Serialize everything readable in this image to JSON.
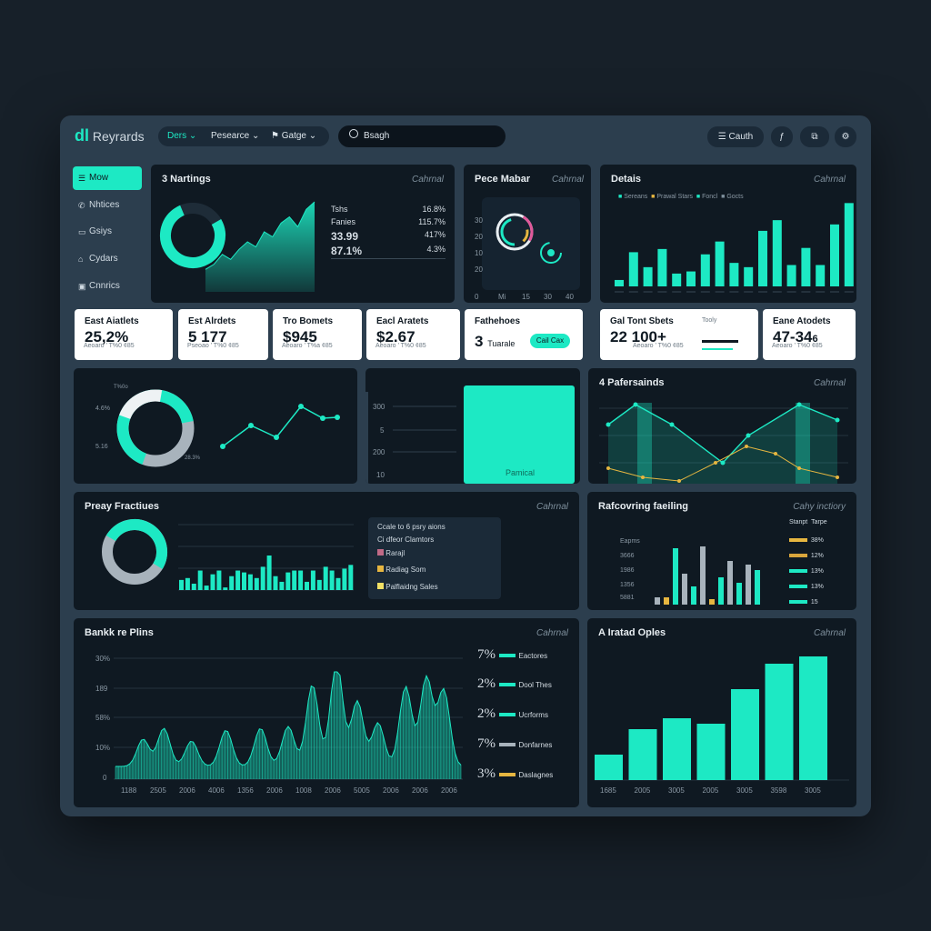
{
  "app": {
    "title": "Reyrards"
  },
  "nav": {
    "items": [
      "Ders",
      "Pesearce",
      "Gatge"
    ]
  },
  "search": {
    "placeholder": "Bsagh"
  },
  "header": {
    "calendar_label": "Cauth"
  },
  "sidebar": {
    "items": [
      "Mow",
      "Nhtices",
      "Gsiys",
      "Cydars",
      "Cnnrics"
    ]
  },
  "panels": {
    "ratings": {
      "title": "3 Nartings",
      "control": "Cahrnal",
      "stats": [
        {
          "label": "Tshs",
          "value": "16.8%"
        },
        {
          "label": "Fanies",
          "value": "115.7%"
        },
        {
          "label": "33.99",
          "value": "417%"
        },
        {
          "label": "87.1%",
          "value": "4.3%"
        }
      ]
    },
    "pece": {
      "title": "Pece Mabar",
      "control": "Cahrnal",
      "ylabels": [
        "30",
        "20",
        "10",
        "20"
      ],
      "xlabels": [
        "0",
        "Mi",
        "15",
        "30",
        "40"
      ]
    },
    "details": {
      "title": "Detais",
      "control": "Cahrnal",
      "legend": [
        "Sereans",
        "Prawal Stars",
        "Foncl",
        "Gocts"
      ]
    },
    "pref": {
      "title": "4 Pafersainds",
      "control": "Cahrnal"
    },
    "prey": {
      "title": "Preay Fractiues",
      "control": "Cahrnal"
    },
    "recov": {
      "title": "Rafcovring faeiling",
      "control": "Cahy inctiory",
      "legend_headers": [
        "Stanpt",
        "Tarpe"
      ],
      "legend_vals": [
        "38%",
        "12%",
        "13%",
        "13%",
        "15"
      ]
    },
    "bank": {
      "title": "Bankk re Plins",
      "control": "Cahrnal"
    },
    "irated": {
      "title": "A Iratad Oples",
      "control": "Cahrnal"
    }
  },
  "cards": [
    {
      "label": "East Aiatlets",
      "value": "25,2%",
      "sub": "Aeoaro ’ T%0 ¢85"
    },
    {
      "label": "Est Alrdets",
      "value": "5 177",
      "sub": "Pseoao ’ T%0 ¢85"
    },
    {
      "label": "Tro Bomets",
      "value": "$945",
      "sub": "Aeoaro ’ T%a ¢85"
    },
    {
      "label": "Eacl Aratets",
      "value": "$2.67",
      "sub": "Aeoaro ’ T%0 ¢85"
    },
    {
      "label": "Fathehoes",
      "value": "3",
      "unit": "Tuarale",
      "button": "Cail Cax"
    },
    {
      "label": "Gal Tont Sbets",
      "value": "22 100+",
      "sub": "Aeoaro ’ T%0 ¢85",
      "mini": "Tooly"
    },
    {
      "label": "Eane Atodets",
      "value": "47-34",
      "unit": "6",
      "sub": "Aeoaro ’ T%0 ¢85"
    }
  ],
  "mid": {
    "bar_label": "Pamical",
    "yticks": [
      "300",
      "5",
      "200",
      "10"
    ],
    "donut_labels": [
      "T%0o",
      "4.6%",
      "5.16",
      "28.3%"
    ]
  },
  "prey_legend": {
    "title": "Ccale to 6 psry aions",
    "subtitle": "Ci dfeor Clamtors",
    "items": [
      {
        "label": "Rarajl",
        "color": "#c06a86"
      },
      {
        "label": "Radiag Som",
        "color": "#e6b640"
      },
      {
        "label": "Palflaidng Sales",
        "color": "#f2e065"
      }
    ]
  },
  "bank_legend": [
    {
      "pct": "7%",
      "label": "Eactores"
    },
    {
      "pct": "2%",
      "label": "Dool Thes"
    },
    {
      "pct": "2%",
      "label": "Ucrforms"
    },
    {
      "pct": "7%",
      "label": "Donfarnes"
    },
    {
      "pct": "3%",
      "label": "Daslagnes"
    }
  ],
  "bank_axes": {
    "y": [
      "30%",
      "189",
      "58%",
      "10%",
      "0"
    ],
    "x": [
      "1188",
      "2505",
      "2006",
      "4006",
      "1356",
      "2006",
      "1008",
      "2006",
      "5005",
      "2006",
      "2006",
      "2006"
    ]
  },
  "irated_axes": {
    "x": [
      "1685",
      "2005",
      "3005",
      "2005",
      "3005",
      "3598",
      "3005"
    ]
  },
  "recov_axes": {
    "y": [
      "Eapms",
      "3666",
      "1986",
      "1356",
      "5881"
    ]
  },
  "chart_data": [
    {
      "type": "area",
      "title": "3 Nartings",
      "values": [
        18,
        22,
        30,
        26,
        34,
        40,
        36,
        48,
        44,
        55,
        60,
        52,
        66,
        72
      ]
    },
    {
      "type": "bar",
      "title": "Detais",
      "values": [
        6,
        32,
        18,
        35,
        12,
        14,
        30,
        42,
        22,
        18,
        52,
        62,
        20,
        36,
        20,
        58,
        78
      ]
    },
    {
      "type": "bar",
      "title": "Preay Fractiues",
      "values": [
        34,
        36,
        30,
        44,
        28,
        40,
        44,
        26,
        38,
        44,
        42,
        40,
        36,
        48,
        60,
        38,
        32,
        42,
        44,
        44,
        32,
        44,
        34,
        48,
        44,
        36,
        46,
        50
      ]
    },
    {
      "type": "bar",
      "title": "A Iratad Oples",
      "values": [
        28,
        56,
        68,
        62,
        100,
        128,
        136
      ]
    },
    {
      "type": "area",
      "title": "Bankk re Plins"
    }
  ]
}
